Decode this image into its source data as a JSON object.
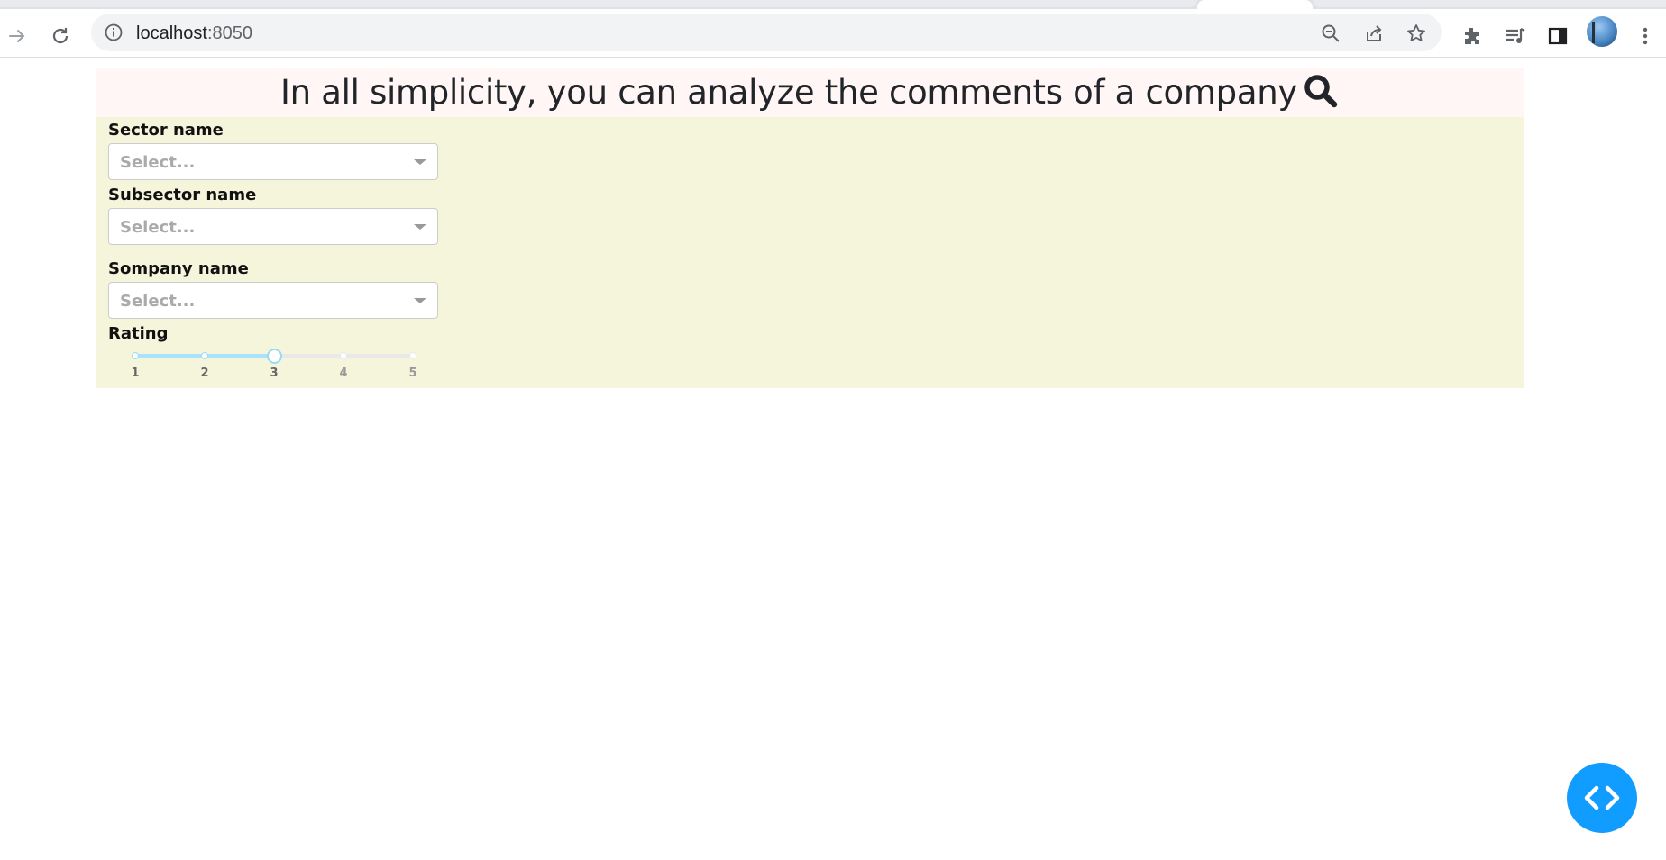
{
  "browser": {
    "url_host": "localhost",
    "url_port": ":8050",
    "icons": [
      "back-arrow-icon",
      "reload-icon",
      "info-icon",
      "zoom-out-icon",
      "share-icon",
      "star-icon",
      "extensions-icon",
      "media-icon",
      "side-panel-icon",
      "avatar",
      "menu-icon"
    ]
  },
  "header": {
    "title": "In all simplicity, you can analyze the comments of a company",
    "icon": "search-icon",
    "background": "#fff6f5"
  },
  "filters": {
    "background": "#f5f5dc",
    "sector": {
      "label": "Sector name",
      "placeholder": "Select..."
    },
    "subsector": {
      "label": "Subsector name",
      "placeholder": "Select..."
    },
    "company": {
      "label": "Sompany name",
      "placeholder": "Select..."
    },
    "rating": {
      "label": "Rating",
      "marks": [
        "1",
        "2",
        "3",
        "4",
        "5"
      ],
      "min": 1,
      "max": 5,
      "value": 3
    }
  },
  "dev_tools_button": {
    "icon": "code-brackets-icon",
    "color": "#119dff"
  }
}
